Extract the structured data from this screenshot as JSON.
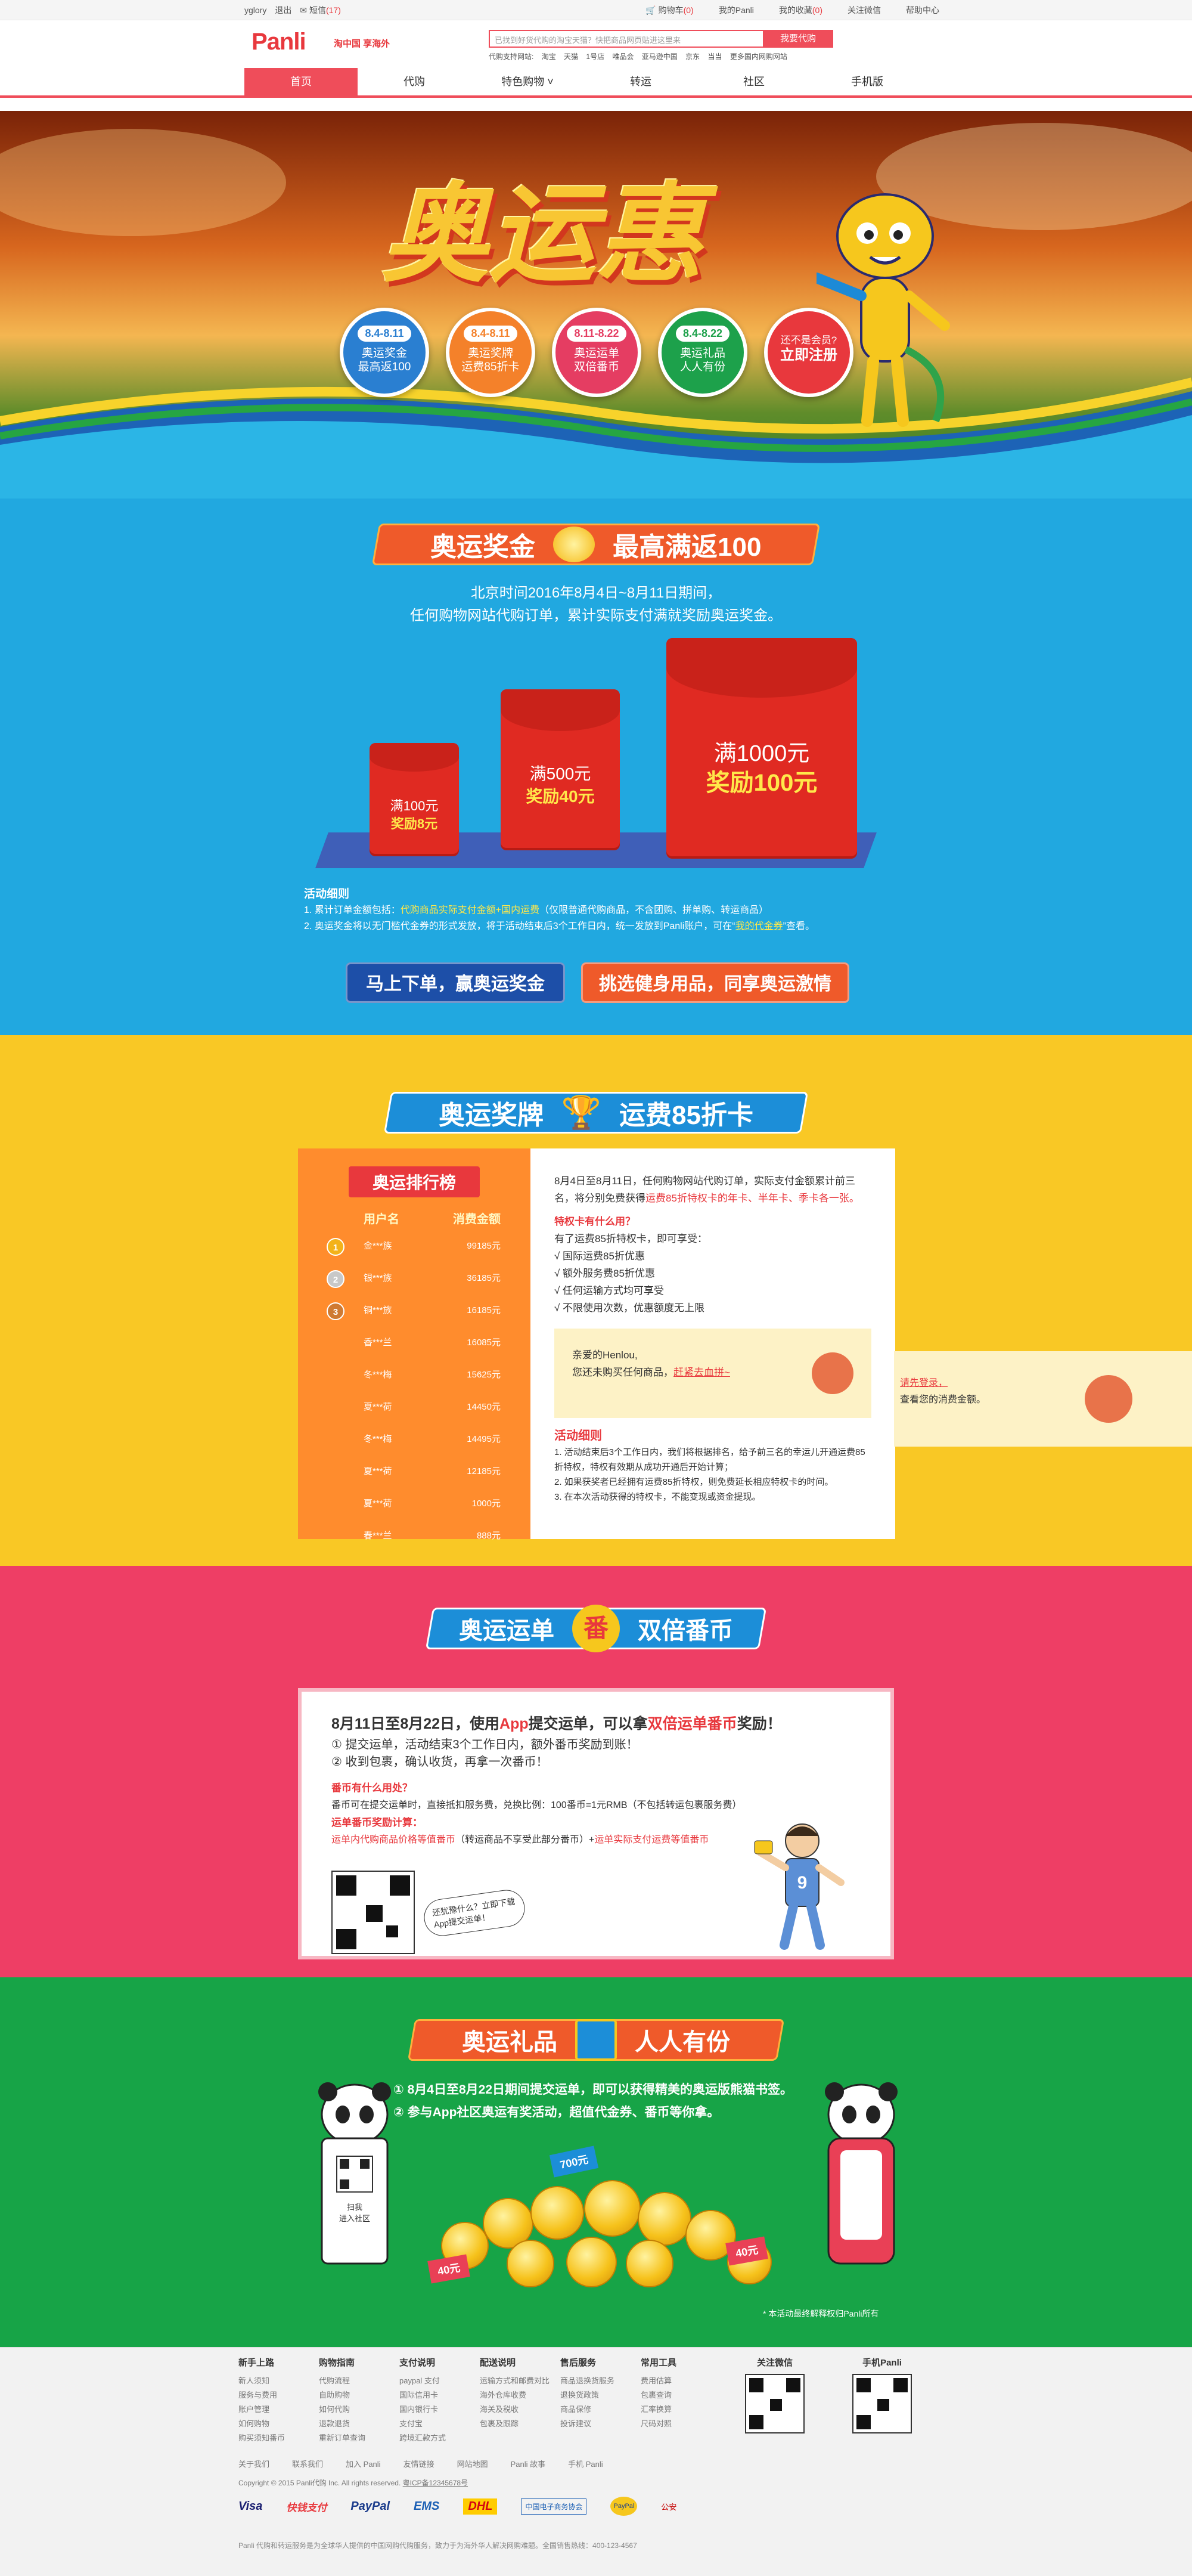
{
  "topbar": {
    "user": "yglory",
    "logout": "退出",
    "messages": "短信",
    "msg_count": "(17)",
    "cart": "购物车",
    "cart_count": "(0)",
    "mypanli": "我的Panli",
    "favorites": "我的收藏",
    "fav_count": "(0)",
    "follow": "关注微信",
    "help": "帮助中心"
  },
  "header": {
    "logo": "Panli",
    "slogan": "淘中国 享海外",
    "search_placeholder": "已找到好货代购的淘宝天猫？快把商品网页贴进这里来",
    "search_button": "我要代购",
    "hot_label": "代购支持网站:",
    "hot_sites": [
      "淘宝",
      "天猫",
      "1号店",
      "唯品会",
      "亚马逊中国",
      "京东",
      "当当",
      "更多国内网购网站"
    ]
  },
  "nav": {
    "items": [
      "首页",
      "代购",
      "特色购物 ˅",
      "转运",
      "社区",
      "手机版"
    ]
  },
  "hero": {
    "title": "奥运惠",
    "badges": [
      {
        "date": "8.4-8.11",
        "line1": "奥运奖金",
        "line2": "最高返100",
        "color": "#2a7fd1"
      },
      {
        "date": "8.4-8.11",
        "line1": "奥运奖牌",
        "line2": "运费85折卡",
        "color": "#f4812a"
      },
      {
        "date": "8.11-8.22",
        "line1": "奥运运单",
        "line2": "双倍番币",
        "color": "#e53d62"
      },
      {
        "date": "8.4-8.22",
        "line1": "奥运礼品",
        "line2": "人人有份",
        "color": "#1da14b"
      },
      {
        "date": "",
        "line1": "还不是会员?",
        "line2": "立即注册",
        "color": "#e8383d"
      }
    ]
  },
  "sec1": {
    "title_left": "奥运奖金",
    "title_right": "最高满返100",
    "desc1": "北京时间2016年8月4日~8月11日期间，",
    "desc2": "任何购物网站代购订单，累计实际支付满就奖励奥运奖金。",
    "tiers": [
      {
        "cond": "满100元",
        "reward": "奖励8元"
      },
      {
        "cond": "满500元",
        "reward": "奖励40元"
      },
      {
        "cond": "满1000元",
        "reward": "奖励100元"
      }
    ],
    "rules_title": "活动细则",
    "rule1": "1. 累计订单金额包括：",
    "rule1_hl": "代购商品实际支付金额+国内运费",
    "rule1_tail": "（仅限普通代购商品，不含团购、拼单购、转运商品）",
    "rule2": "2. 奥运奖金将以无门槛代金券的形式发放，将于活动结束后3个工作日内，统一发放到Panli账户，可在“",
    "rule2_hl": "我的代金券",
    "rule2_tail": "”查看。",
    "btn1": "马上下单，赢奥运奖金",
    "btn2": "挑选健身用品，同享奥运激情"
  },
  "sec2": {
    "title_left": "奥运奖牌",
    "title_right": "运费85折卡",
    "rank_title": "奥运排行榜",
    "col_user": "用户名",
    "col_amount": "消费金额",
    "rows": [
      {
        "user": "金***族",
        "amount": "99185元"
      },
      {
        "user": "银***族",
        "amount": "36185元"
      },
      {
        "user": "铜***族",
        "amount": "16185元"
      },
      {
        "user": "香***兰",
        "amount": "16085元"
      },
      {
        "user": "冬***梅",
        "amount": "15625元"
      },
      {
        "user": "夏***荷",
        "amount": "14450元"
      },
      {
        "user": "冬***梅",
        "amount": "14495元"
      },
      {
        "user": "夏***荷",
        "amount": "12185元"
      },
      {
        "user": "夏***荷",
        "amount": "1000元"
      },
      {
        "user": "春***兰",
        "amount": "888元"
      }
    ],
    "p1": "8月4日至8月11日，任何购物网站代购订单，实际支付金额累计前三名，将分别免费获得",
    "p1_hl": "运费85折特权卡的年卡、半年卡、季卡各一张。",
    "q_title": "特权卡有什么用？",
    "q_intro": "有了运费85折特权卡，即可享受：",
    "q_items": [
      "√ 国际运费85折优惠",
      "√ 额外服务费85折优惠",
      "√ 任何运输方式均可享受",
      "√ 不限使用次数，优惠额度无上限"
    ],
    "hello": "亲爱的Henlou,",
    "hello_text": "您还未购买任何商品，",
    "hello_link": "赶紧去血拼~",
    "login_prompt": "请先登录，",
    "login_text": "查看您的消费金额。",
    "rules_title": "活动细则",
    "rules": [
      "1. 活动结束后3个工作日内，我们将根据排名，给予前三名的幸运儿开通运费85折特权，特权有效期从成功开通后开始计算；",
      "2. 如果获奖者已经拥有运费85折特权，则免费延长相应特权卡的时间。",
      "3. 在本次活动获得的特权卡，不能变现或资金提现。"
    ]
  },
  "sec3": {
    "title_left": "奥运运单",
    "title_mid": "番",
    "title_right": "双倍番币",
    "headline": "8月11日至8月22日，使用",
    "headline_app": "App",
    "headline_mid": "提交运单，可以拿",
    "headline_hl": "双倍运单番币",
    "headline_tail": "奖励！",
    "step1": "① 提交运单，活动结束3个工作日内，额外番币奖励到账！",
    "step2": "② 收到包裹，确认收货，再拿一次番币！",
    "q1": "番币有什么用处？",
    "a1": "番币可在提交运单时，直接抵扣服务费，兑换比例：100番币=1元RMB（不包括转运包裹服务费）",
    "q2": "运单番币奖励计算：",
    "a2_hl": "运单内代购商品价格等值番币",
    "a2_mid": "（转运商品不享受此部分番币）+",
    "a2_hl2": "运单实际支付运费等值番币",
    "qr_note": "还犹豫什么？立即下载App提交运单！",
    "player_number": "9"
  },
  "sec4": {
    "title_left": "奥运礼品",
    "title_right": "人人有份",
    "line1": "① 8月4日至8月22日期间提交运单，即可以获得精美的奥运版熊猫书签。",
    "line2": "② 参与App社区奥运有奖活动，超值代金券、番币等你拿。",
    "tag_700": "700元",
    "tag_40a": "40元",
    "tag_40b": "40元",
    "qr_caption": "扫我\n进入社区",
    "note": "* 本活动最终解释权归Panli所有"
  },
  "footer": {
    "cols": [
      {
        "h": "新手上路",
        "items": [
          "新人须知",
          "服务与费用",
          "账户管理",
          "如何购物",
          "购买须知番币"
        ]
      },
      {
        "h": "购物指南",
        "items": [
          "代购流程",
          "自助购物",
          "如何代购",
          "退款退货",
          "重新订单查询"
        ]
      },
      {
        "h": "支付说明",
        "items": [
          "paypal 支付",
          "国际信用卡",
          "国内银行卡",
          "支付宝",
          "跨境汇款方式"
        ]
      },
      {
        "h": "配送说明",
        "items": [
          "运输方式和邮费对比",
          "海外仓库收费",
          "海关及税收",
          "包裹及跟踪"
        ]
      },
      {
        "h": "售后服务",
        "items": [
          "商品退换货服务",
          "退换货政策",
          "商品保修",
          "投诉建议"
        ]
      },
      {
        "h": "常用工具",
        "items": [
          "费用估算",
          "包裹查询",
          "汇率换算",
          "尺码对照"
        ]
      },
      {
        "h": "关注微信",
        "items": []
      },
      {
        "h": "手机Panli",
        "items": []
      }
    ],
    "links": [
      "关于我们",
      "联系我们",
      "加入 Panli",
      "友情链接",
      "网站地图",
      "Panli 故事",
      "手机 Panli"
    ],
    "copyright": "Copyright © 2015 Panli代购 Inc. All rights reserved.",
    "icp": "粤ICP备12345678号",
    "pay_logos": [
      "Visa",
      "快钱支付",
      "PayPal",
      "EMS",
      "DHL",
      "中国电子商务协会",
      "PayPal",
      "公安"
    ],
    "note": "Panli 代购和转运服务是为全球华人提供的中国网购代购服务，致力于为海外华人解决网购难题。全国销售热线：400-123-4567"
  }
}
